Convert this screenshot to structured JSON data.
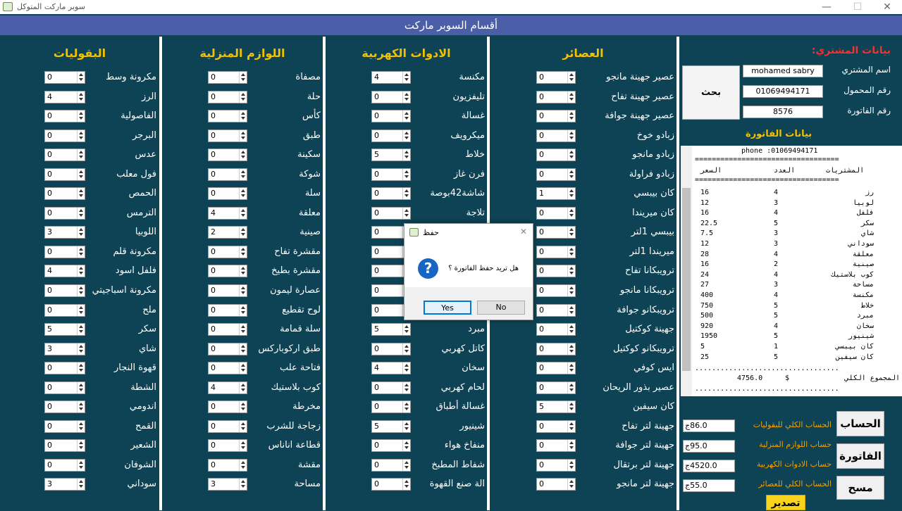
{
  "window": {
    "title": "سوبر ماركت المتوكل"
  },
  "header": {
    "title": "أقسام السوبر ماركت"
  },
  "columns": [
    {
      "title": "العصائر",
      "items": [
        {
          "label": "عصير جهينة مانجو",
          "value": "0"
        },
        {
          "label": "عصير جهينة تفاح",
          "value": "0"
        },
        {
          "label": "عصير جهينة جوافة",
          "value": "0"
        },
        {
          "label": "زبادو خوخ",
          "value": "0"
        },
        {
          "label": "زبادو مانجو",
          "value": "0"
        },
        {
          "label": "زبادو فراولة",
          "value": "0"
        },
        {
          "label": "كان بيبسي",
          "value": "1"
        },
        {
          "label": "كان ميريندا",
          "value": "0"
        },
        {
          "label": "بيبسي 1لتر",
          "value": "0"
        },
        {
          "label": "ميريندا 1لتر",
          "value": "0"
        },
        {
          "label": "ترويبكانا تفاح",
          "value": "0"
        },
        {
          "label": "ترويبكانا مانجو",
          "value": "0"
        },
        {
          "label": "ترويبكانو جوافة",
          "value": "0"
        },
        {
          "label": "جهينة كوكتيل",
          "value": "0"
        },
        {
          "label": "ترويبكانو كوكتيل",
          "value": "0"
        },
        {
          "label": "ايس كوفي",
          "value": "0"
        },
        {
          "label": "عصير بذور الريحان",
          "value": "0"
        },
        {
          "label": "كان سيفين",
          "value": "5"
        },
        {
          "label": "جهينة لتر تفاح",
          "value": "0"
        },
        {
          "label": "جهينة لتر جوافة",
          "value": "0"
        },
        {
          "label": "جهينة لتر برتقال",
          "value": "0"
        },
        {
          "label": "جهينة لتر مانجو",
          "value": "0"
        }
      ]
    },
    {
      "title": "الادوات الكهربية",
      "items": [
        {
          "label": "مكنسة",
          "value": "4"
        },
        {
          "label": "تليفزيون",
          "value": "0"
        },
        {
          "label": "غسالة",
          "value": "0"
        },
        {
          "label": "ميكرويف",
          "value": "0"
        },
        {
          "label": "خلاط",
          "value": "5"
        },
        {
          "label": "فرن غاز",
          "value": "0"
        },
        {
          "label": "شاشة42بوصة",
          "value": "0"
        },
        {
          "label": "تلاجة",
          "value": "0"
        },
        {
          "label": "",
          "value": "0"
        },
        {
          "label": "",
          "value": "0"
        },
        {
          "label": "",
          "value": "0"
        },
        {
          "label": "",
          "value": "0"
        },
        {
          "label": "",
          "value": "0"
        },
        {
          "label": "مبرد",
          "value": "5"
        },
        {
          "label": "كاتل كهربي",
          "value": "0"
        },
        {
          "label": "سخان",
          "value": "4"
        },
        {
          "label": "لحام كهربي",
          "value": "0"
        },
        {
          "label": "غسالة أطباق",
          "value": "0"
        },
        {
          "label": "شينيور",
          "value": "5"
        },
        {
          "label": "منفاخ هواء",
          "value": "0"
        },
        {
          "label": "شفاط المطبخ",
          "value": "0"
        },
        {
          "label": "الة صنع القهوة",
          "value": "0"
        }
      ]
    },
    {
      "title": "اللوازم المنزلية",
      "items": [
        {
          "label": "مصفاة",
          "value": "0"
        },
        {
          "label": "حلة",
          "value": "0"
        },
        {
          "label": "كأس",
          "value": "0"
        },
        {
          "label": "طبق",
          "value": "0"
        },
        {
          "label": "سكينة",
          "value": "0"
        },
        {
          "label": "شوكة",
          "value": "0"
        },
        {
          "label": "سلة",
          "value": "0"
        },
        {
          "label": "معلقة",
          "value": "4"
        },
        {
          "label": "صينية",
          "value": "2"
        },
        {
          "label": "مقشرة تفاح",
          "value": "0"
        },
        {
          "label": "مقشرة بطيخ",
          "value": "0"
        },
        {
          "label": "عصارة ليمون",
          "value": "0"
        },
        {
          "label": "لوح تقطيع",
          "value": "0"
        },
        {
          "label": "سلة قمامة",
          "value": "0"
        },
        {
          "label": "طبق اركوباركس",
          "value": "0"
        },
        {
          "label": "فتاحة علب",
          "value": "0"
        },
        {
          "label": "كوب بلاستيك",
          "value": "4"
        },
        {
          "label": "مخرطة",
          "value": "0"
        },
        {
          "label": "زجاجة للشرب",
          "value": "0"
        },
        {
          "label": "قطاعة اناناس",
          "value": "0"
        },
        {
          "label": "مقشة",
          "value": "0"
        },
        {
          "label": "مساحة",
          "value": "3"
        }
      ]
    },
    {
      "title": "البقوليات",
      "items": [
        {
          "label": "مكرونة وسط",
          "value": "0"
        },
        {
          "label": "الرز",
          "value": "4"
        },
        {
          "label": "الفاصولية",
          "value": "0"
        },
        {
          "label": "البرجر",
          "value": "0"
        },
        {
          "label": "عدس",
          "value": "0"
        },
        {
          "label": "فول معلب",
          "value": "0"
        },
        {
          "label": "الحمص",
          "value": "0"
        },
        {
          "label": "الترمس",
          "value": "0"
        },
        {
          "label": "اللوبيا",
          "value": "3"
        },
        {
          "label": "مكرونة قلم",
          "value": "0"
        },
        {
          "label": "فلفل اسود",
          "value": "4"
        },
        {
          "label": "مكرونة اسباجيتي",
          "value": "0"
        },
        {
          "label": "ملح",
          "value": "0"
        },
        {
          "label": "سكر",
          "value": "5"
        },
        {
          "label": "شاي",
          "value": "3"
        },
        {
          "label": "قهوة النجار",
          "value": "0"
        },
        {
          "label": "الشطة",
          "value": "0"
        },
        {
          "label": "اندومي",
          "value": "0"
        },
        {
          "label": "القمح",
          "value": "0"
        },
        {
          "label": "الشعير",
          "value": "0"
        },
        {
          "label": "الشوفان",
          "value": "0"
        },
        {
          "label": "سوداني",
          "value": "3"
        }
      ]
    }
  ],
  "customer": {
    "section_title": "بيانات المشتري:",
    "name_label": "اسم المشتري",
    "name_value": "mohamed sabry",
    "phone_label": "رقم المحمول",
    "phone_value": "01069494171",
    "invoice_label": "رقم الفاتورة",
    "invoice_value": "8576",
    "search_button": "بحث"
  },
  "invoice": {
    "section_title": "بيانات الفاتورة",
    "phone_line": "phone :01069494171",
    "separator": "==================================",
    "col_price": "السعر",
    "col_qty": "العدد",
    "col_item": "المشتريات",
    "lines": [
      {
        "price": "16",
        "qty": "4",
        "item": "رز"
      },
      {
        "price": "12",
        "qty": "3",
        "item": "لوبيا"
      },
      {
        "price": "16",
        "qty": "4",
        "item": "فلفل"
      },
      {
        "price": "22.5",
        "qty": "5",
        "item": "سكر"
      },
      {
        "price": "7.5",
        "qty": "3",
        "item": "شاي"
      },
      {
        "price": "12",
        "qty": "3",
        "item": "سوداني"
      },
      {
        "price": "28",
        "qty": "4",
        "item": "معلقة"
      },
      {
        "price": "16",
        "qty": "2",
        "item": "صينية"
      },
      {
        "price": "24",
        "qty": "4",
        "item": "كوب بلاستيك"
      },
      {
        "price": "27",
        "qty": "3",
        "item": "مساحة"
      },
      {
        "price": "400",
        "qty": "4",
        "item": "مكنسة"
      },
      {
        "price": "750",
        "qty": "5",
        "item": "خلاط"
      },
      {
        "price": "500",
        "qty": "5",
        "item": "مبرد"
      },
      {
        "price": "920",
        "qty": "4",
        "item": "سخان"
      },
      {
        "price": "1950",
        "qty": "5",
        "item": "شينيور"
      },
      {
        "price": "5",
        "qty": "1",
        "item": "كان بيبسي"
      },
      {
        "price": "25",
        "qty": "5",
        "item": "كان سيفين"
      }
    ],
    "dots": "..................................",
    "total_amount": "4756.0",
    "currency": "$",
    "total_label": "المجموع الكلي"
  },
  "totals": [
    {
      "label": "الحساب الكلي للبقوليات",
      "value": "86.0ج"
    },
    {
      "label": "حساب اللوازم المنزلية",
      "value": "95.0ج"
    },
    {
      "label": "حساب الادوات الكهربية",
      "value": "4520.0ج"
    },
    {
      "label": "الحساب الكلي للعصائر",
      "value": "55.0ج"
    }
  ],
  "buttons": {
    "calc": "الحساب",
    "invoice": "الفاتورة",
    "clear": "مسح",
    "export": "تصدير"
  },
  "dialog": {
    "title": "حفظ",
    "message": "هل تريد حفظ الفاتورة ؟",
    "yes": "Yes",
    "no": "No"
  },
  "colors": {
    "background": "#0e4355",
    "header": "#4a5fa8",
    "heading": "#f2c200",
    "totals_label": "#f2a000",
    "export_button": "#f7d31b"
  }
}
